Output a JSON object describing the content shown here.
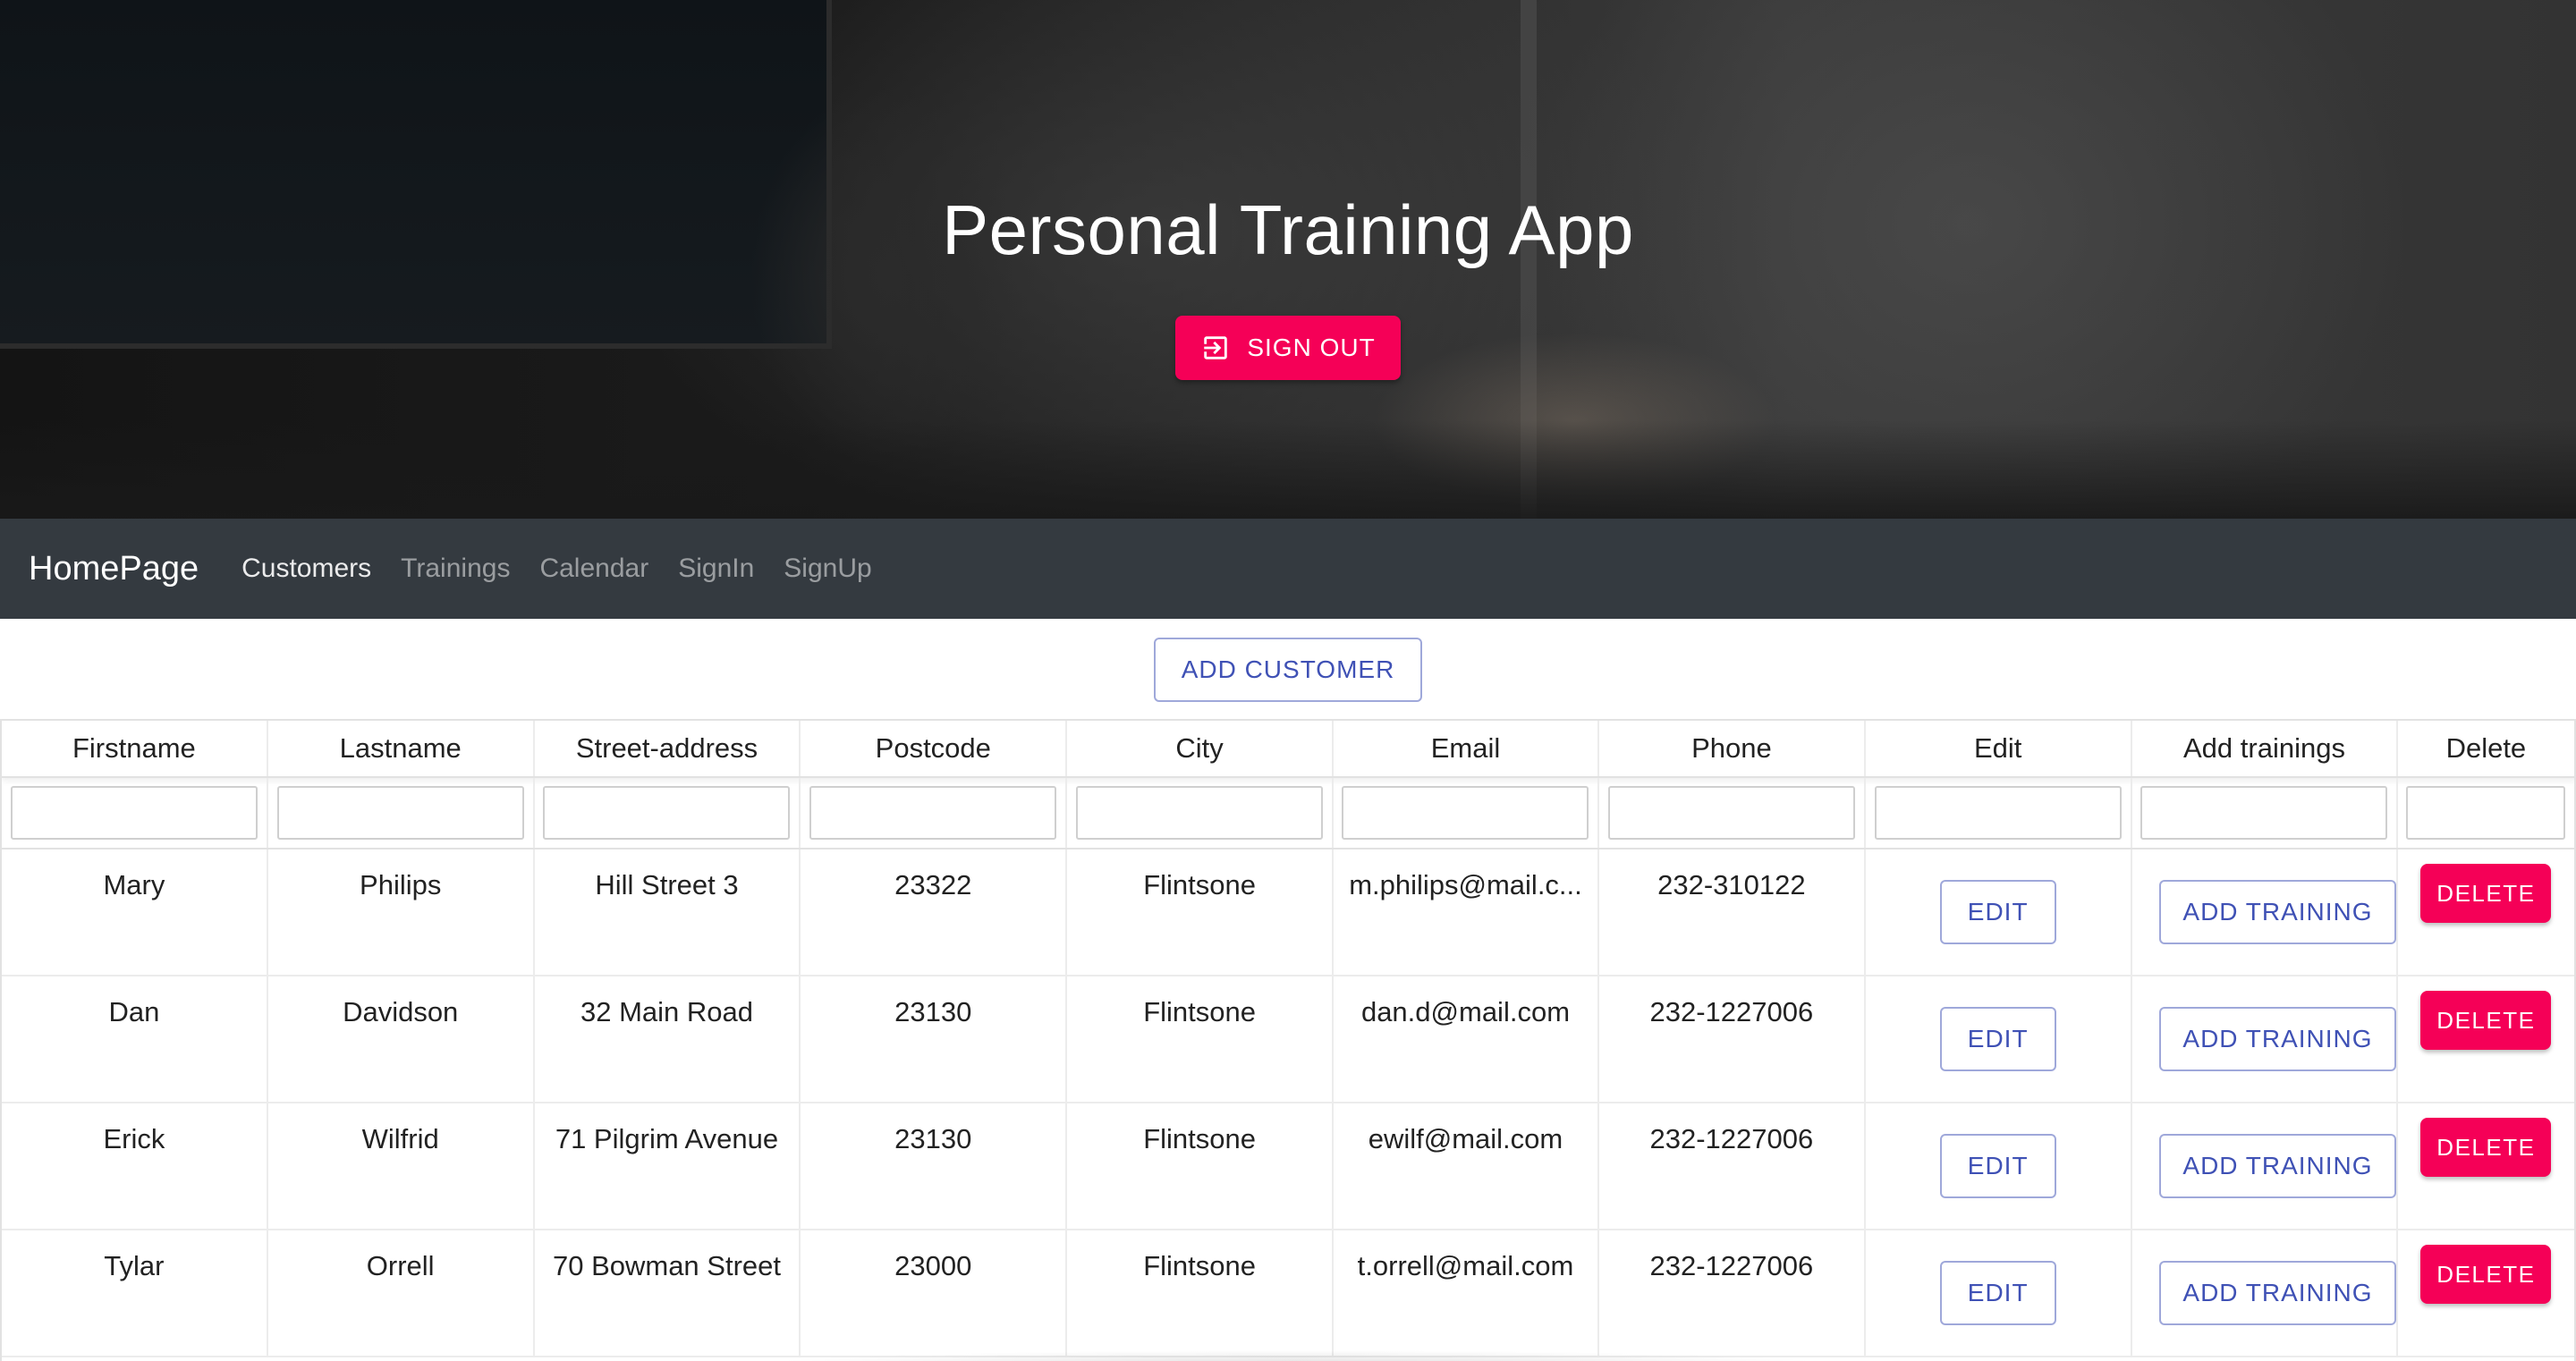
{
  "hero": {
    "title": "Personal Training App",
    "signout_label": "SIGN OUT",
    "signout_icon": "sign-out-icon"
  },
  "navbar": {
    "brand": "HomePage",
    "links": [
      "Customers",
      "Trainings",
      "Calendar",
      "SignIn",
      "SignUp"
    ],
    "active": "Customers"
  },
  "toolbar": {
    "add_customer_label": "ADD CUSTOMER"
  },
  "table": {
    "columns": [
      "Firstname",
      "Lastname",
      "Street-address",
      "Postcode",
      "City",
      "Email",
      "Phone",
      "Edit",
      "Add trainings",
      "Delete"
    ],
    "rows": [
      {
        "firstname": "Mary",
        "lastname": "Philips",
        "street": "Hill Street 3",
        "postcode": "23322",
        "city": "Flintsone",
        "email": "m.philips@mail.c...",
        "phone": "232-310122"
      },
      {
        "firstname": "Dan",
        "lastname": "Davidson",
        "street": "32 Main Road",
        "postcode": "23130",
        "city": "Flintsone",
        "email": "dan.d@mail.com",
        "phone": "232-1227006"
      },
      {
        "firstname": "Erick",
        "lastname": "Wilfrid",
        "street": "71 Pilgrim Avenue",
        "postcode": "23130",
        "city": "Flintsone",
        "email": "ewilf@mail.com",
        "phone": "232-1227006"
      },
      {
        "firstname": "Tylar",
        "lastname": "Orrell",
        "street": "70 Bowman Street",
        "postcode": "23000",
        "city": "Flintsone",
        "email": "t.orrell@mail.com",
        "phone": "232-1227006"
      }
    ],
    "edit_label": "EDIT",
    "add_training_label": "ADD TRAINING",
    "delete_label": "DELETE"
  },
  "colors": {
    "accent": "#f50057",
    "primary": "#3f51b5",
    "navbar": "#343a40"
  }
}
